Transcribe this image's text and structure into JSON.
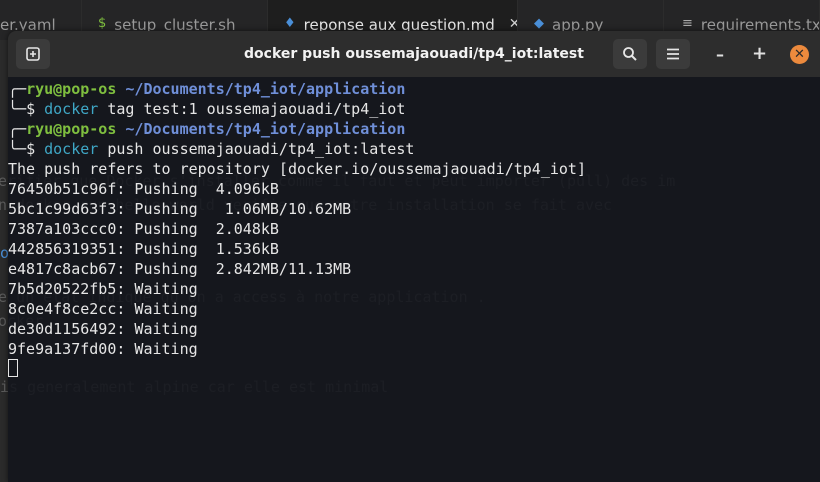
{
  "editor_tabs": [
    {
      "label": "er.yaml",
      "icon": ""
    },
    {
      "label": "setup_cluster.sh",
      "icon": "$"
    },
    {
      "label": "reponse aux question.md",
      "icon": "♦",
      "active": true
    },
    {
      "label": "app.py",
      "icon": "◆"
    },
    {
      "label": "requirements.txt",
      "icon": "≡"
    }
  ],
  "editor_bg_lines": [
    "erifier que Docker s'installer comme il faut et peut importer (pull) des im",
    "n docker run hello-world verifie que notre installation se fait avec",
    "o",
    "e un etat indique qu'on a access à notre application .",
    "ocker",
    "is generalement alpine car elle est minimal"
  ],
  "terminal": {
    "title": "docker push oussemajaouadi/tp4_iot:latest",
    "prompt_user": "ryu@pop-os",
    "prompt_path": "~/Documents/tp4_iot/application",
    "commands": [
      {
        "cmd": "docker",
        "args": " tag test:1 oussemajaouadi/tp4_iot"
      },
      {
        "cmd": "docker",
        "args": " push oussemajaouadi/tp4_iot:latest"
      }
    ],
    "output": [
      "The push refers to repository [docker.io/oussemajaouadi/tp4_iot]",
      "76450b51c96f: Pushing  4.096kB",
      "5bc1c99d63f3: Pushing   1.06MB/10.62MB",
      "7387a103ccc0: Pushing  2.048kB",
      "442856319351: Pushing  1.536kB",
      "e4817c8acb67: Pushing  2.842MB/11.13MB",
      "7b5d20522fb5: Waiting",
      "8c0e4f8ce2cc: Waiting",
      "de30d1156492: Waiting",
      "9fe9a137fd00: Waiting"
    ]
  }
}
